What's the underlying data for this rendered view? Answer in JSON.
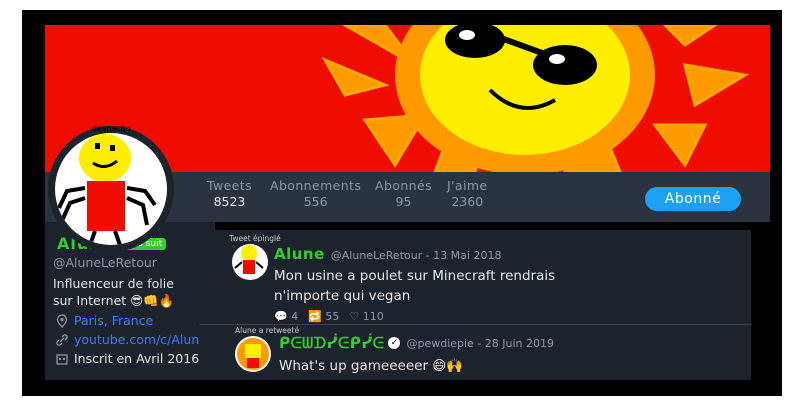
{
  "profile": {
    "avatar_caption": "despacito",
    "name": "Alune",
    "follows_you": "Vous suit",
    "handle": "@AluneLeRetour",
    "bio_line1": "Influenceur de folie",
    "bio_line2": "sur Internet",
    "bio_emojis": "😎👊🔥",
    "location": "Paris, France",
    "website": "youtube.com/c/Alune",
    "joined": "Inscrit en Avril 2016"
  },
  "stats": [
    {
      "label": "Tweets",
      "value": "8523"
    },
    {
      "label": "Abonnements",
      "value": "556"
    },
    {
      "label": "Abonnés",
      "value": "95"
    },
    {
      "label": "J'aime",
      "value": "2360"
    }
  ],
  "follow_button": "Abonné",
  "tweets": [
    {
      "context": "Tweet épinglé",
      "name": "Alune",
      "handle_date": "@AluneLeRetour - 13 Mai 2018",
      "text_line1": "Mon usine a poulet sur Minecraft rendrais",
      "text_line2": "n'importe qui vegan",
      "replies": "4",
      "retweets": "55",
      "likes": "110"
    },
    {
      "context": "Alune a retweeté",
      "name": "ᑭᕮᗯᗪᓰᕮᑭᓰᕮ",
      "handle_date": "@pewdiepie - 28 Juin 2019",
      "text": "What's up gameeeeer 😄🙌"
    }
  ],
  "colors": {
    "banner_red": "#ee0d00",
    "sun_yellow": "#ffee00",
    "sun_orange": "#ff9900",
    "name_green": "#33cc33",
    "accent_blue": "#1da1f2",
    "panel_bg": "#1d232c"
  }
}
